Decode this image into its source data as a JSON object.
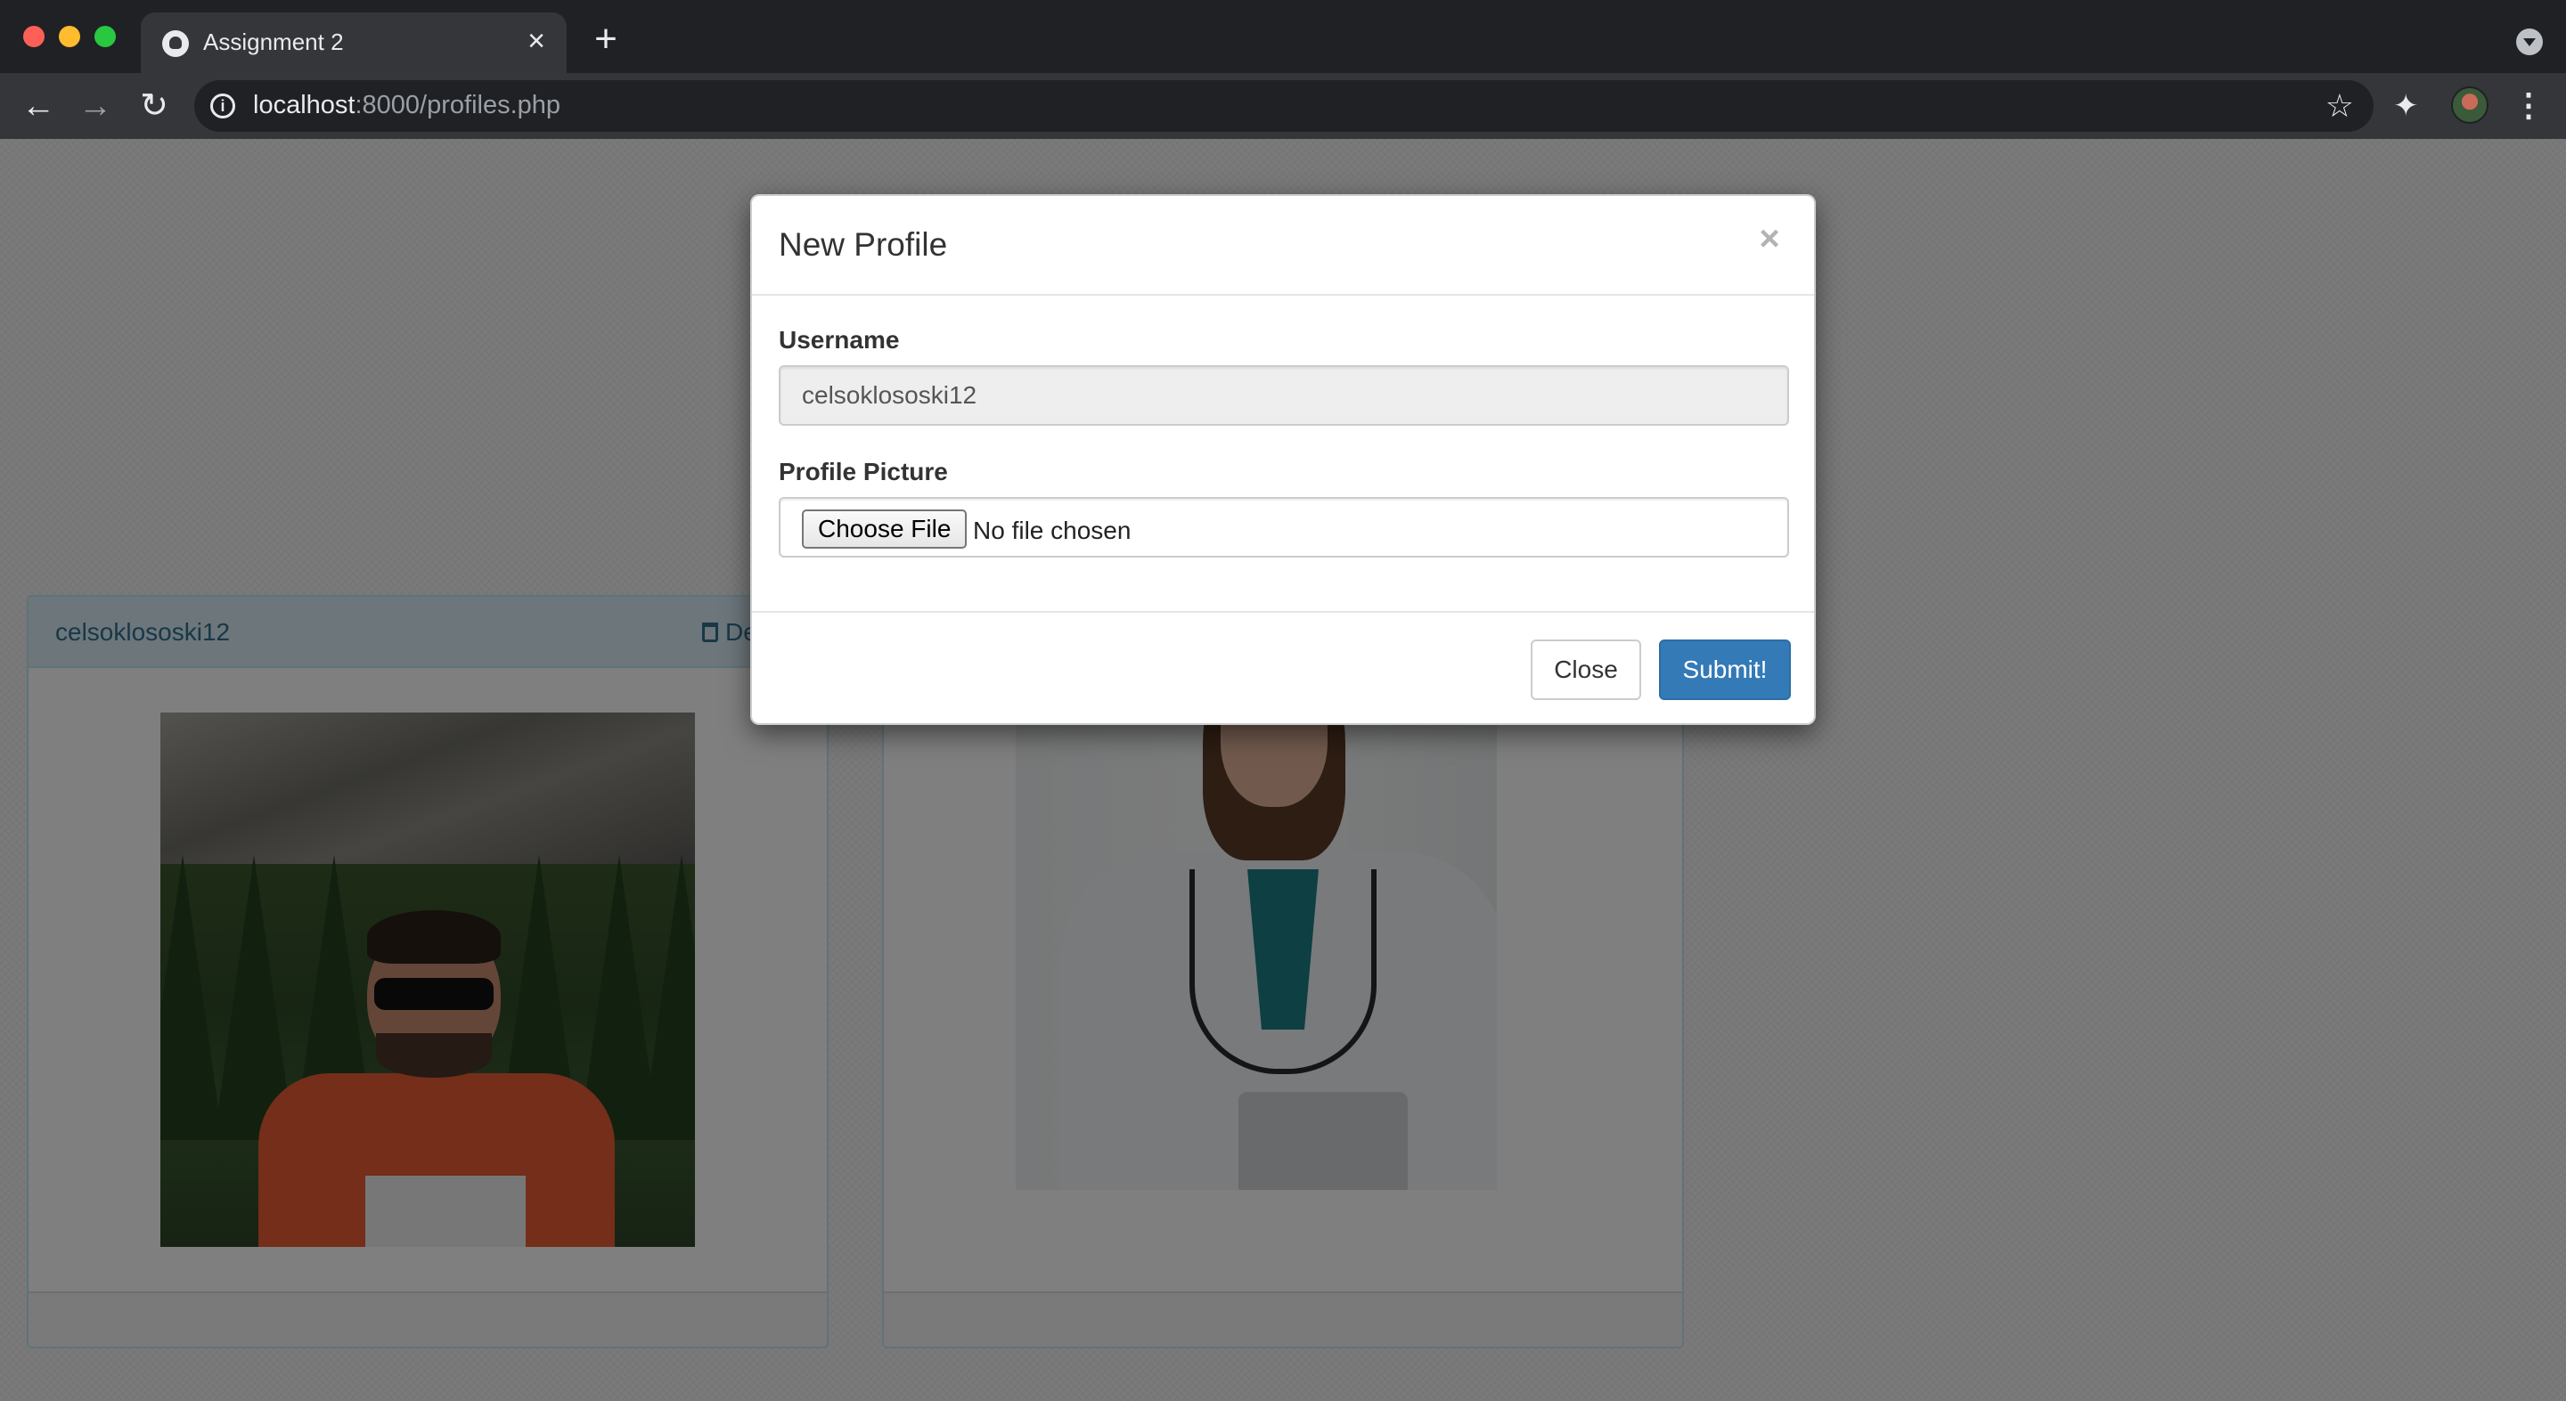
{
  "browser": {
    "tab_title": "Assignment 2",
    "url_host": "localhost",
    "url_path": ":8000/profiles.php"
  },
  "page": {
    "profiles": [
      {
        "username": "celsoklososki12",
        "delete_label": "De"
      },
      {
        "username": "",
        "delete_label": ""
      }
    ]
  },
  "modal": {
    "title": "New Profile",
    "close_glyph": "×",
    "username_label": "Username",
    "username_value": "celsoklososki12",
    "picture_label": "Profile Picture",
    "choose_file_label": "Choose File",
    "file_status": "No file chosen",
    "close_button": "Close",
    "submit_button": "Submit!"
  },
  "colors": {
    "submit": "#337ab7",
    "panel_header": "#d9edf7",
    "panel_border": "#bce8f1"
  }
}
